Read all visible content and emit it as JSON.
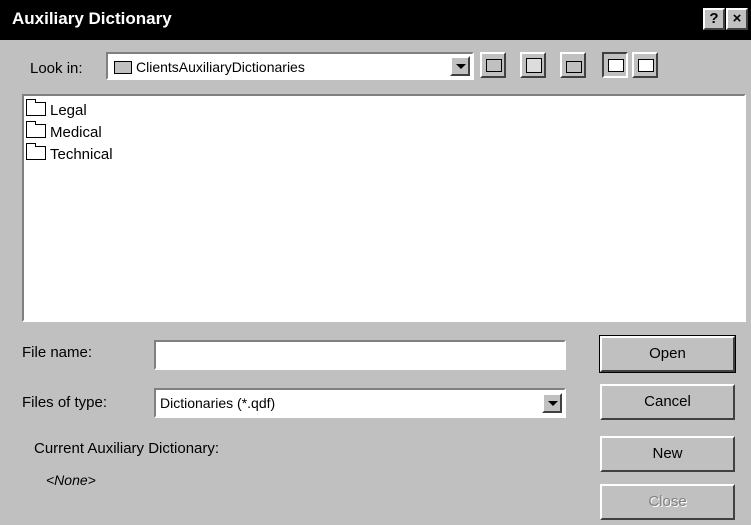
{
  "window": {
    "title": "Auxiliary Dictionary",
    "help_glyph": "?",
    "close_glyph": "×"
  },
  "lookin": {
    "label": "Look in:",
    "value": "ClientsAuxiliaryDictionaries",
    "icon": "folder-icon"
  },
  "toolbar": {
    "icons": [
      "up-one-level-icon",
      "desktop-icon",
      "new-folder-icon",
      "list-view-icon",
      "details-view-icon"
    ]
  },
  "files": [
    {
      "name": "Legal",
      "icon": "folder-icon"
    },
    {
      "name": "Medical",
      "icon": "folder-icon"
    },
    {
      "name": "Technical",
      "icon": "folder-icon"
    }
  ],
  "filename": {
    "label": "File name:",
    "value": ""
  },
  "filetype": {
    "label": "Files of type:",
    "value": "Dictionaries (*.qdf)"
  },
  "current": {
    "label": "Current Auxiliary Dictionary:",
    "value": "<None>"
  },
  "buttons": {
    "open": "Open",
    "cancel": "Cancel",
    "new": "New",
    "close": "Close"
  }
}
